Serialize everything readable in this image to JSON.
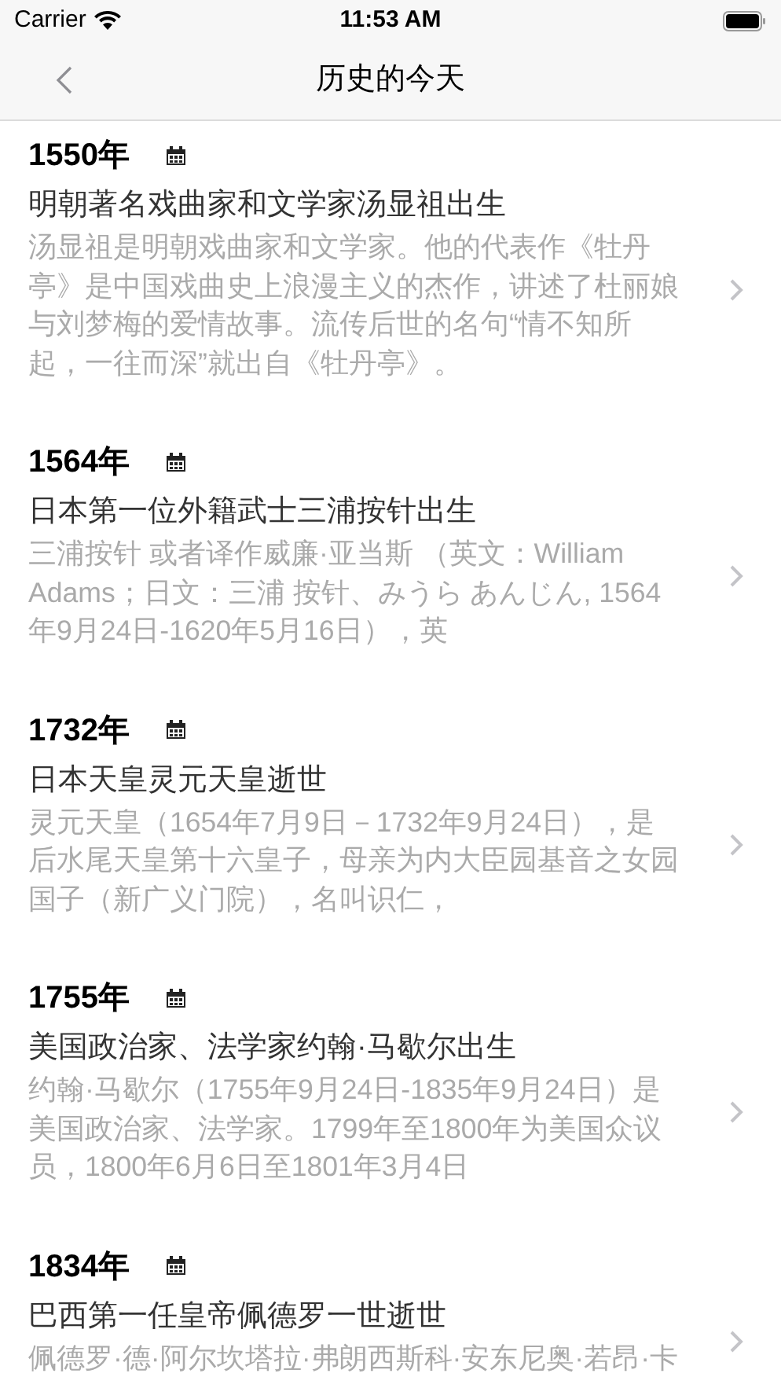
{
  "status_bar": {
    "carrier": "Carrier",
    "time": "11:53 AM"
  },
  "nav": {
    "title": "历史的今天"
  },
  "events": [
    {
      "year": "1550年",
      "title": "明朝著名戏曲家和文学家汤显祖出生",
      "description": "汤显祖是明朝戏曲家和文学家。他的代表作《牡丹亭》是中国戏曲史上浪漫主义的杰作，讲述了杜丽娘与刘梦梅的爱情故事。流传后世的名句“情不知所起，一往而深”就出自《牡丹亭》。"
    },
    {
      "year": "1564年",
      "title": "日本第一位外籍武士三浦按针出生",
      "description": "三浦按针 或者译作威廉·亚当斯 （英文：William Adams；日文：三浦 按针、みうら あんじん, 1564年9月24日-1620年5月16日），英"
    },
    {
      "year": "1732年",
      "title": "日本天皇灵元天皇逝世",
      "description": "灵元天皇（1654年7月9日－1732年9月24日），是后水尾天皇第十六皇子，母亲为内大臣园基音之女园国子（新广义门院），名叫识仁，"
    },
    {
      "year": "1755年",
      "title": "美国政治家、法学家约翰·马歇尔出生",
      "description": "约翰·马歇尔（1755年9月24日-1835年9月24日）是美国政治家、法学家。1799年至1800年为美国众议员，1800年6月6日至1801年3月4日"
    },
    {
      "year": "1834年",
      "title": "巴西第一任皇帝佩德罗一世逝世",
      "description": "佩德罗·德·阿尔坎塔拉·弗朗西斯科·安东尼奥·若昂·卡"
    }
  ]
}
